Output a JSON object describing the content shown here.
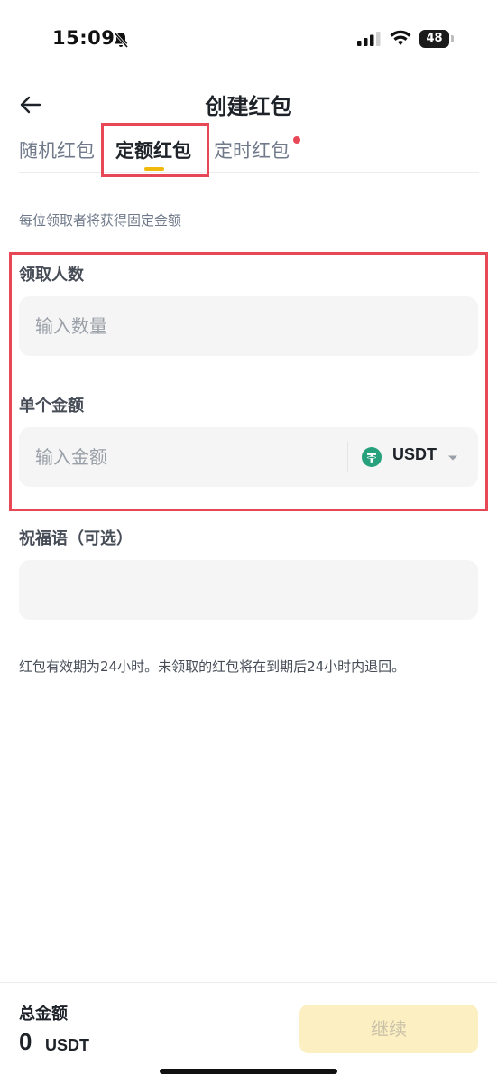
{
  "status_bar": {
    "time": "15:09",
    "battery": "48"
  },
  "header": {
    "title": "创建红包"
  },
  "tabs": [
    {
      "label": "随机红包"
    },
    {
      "label": "定额红包"
    },
    {
      "label": "定时红包"
    }
  ],
  "form": {
    "description": "每位领取者将获得固定金额",
    "recipients_label": "领取人数",
    "recipients_placeholder": "输入数量",
    "amount_label": "单个金额",
    "amount_placeholder": "输入金额",
    "currency": "USDT",
    "greeting_label": "祝福语（可选）",
    "greeting_placeholder": "",
    "note": "红包有效期为24小时。未领取的红包将在到期后24小时内退回。"
  },
  "footer": {
    "total_label": "总金额",
    "total_value": "0",
    "total_unit": "USDT",
    "continue_label": "继续"
  },
  "colors": {
    "accent": "#f0b90b",
    "highlight": "#e84856",
    "usdt": "#26a17b"
  }
}
